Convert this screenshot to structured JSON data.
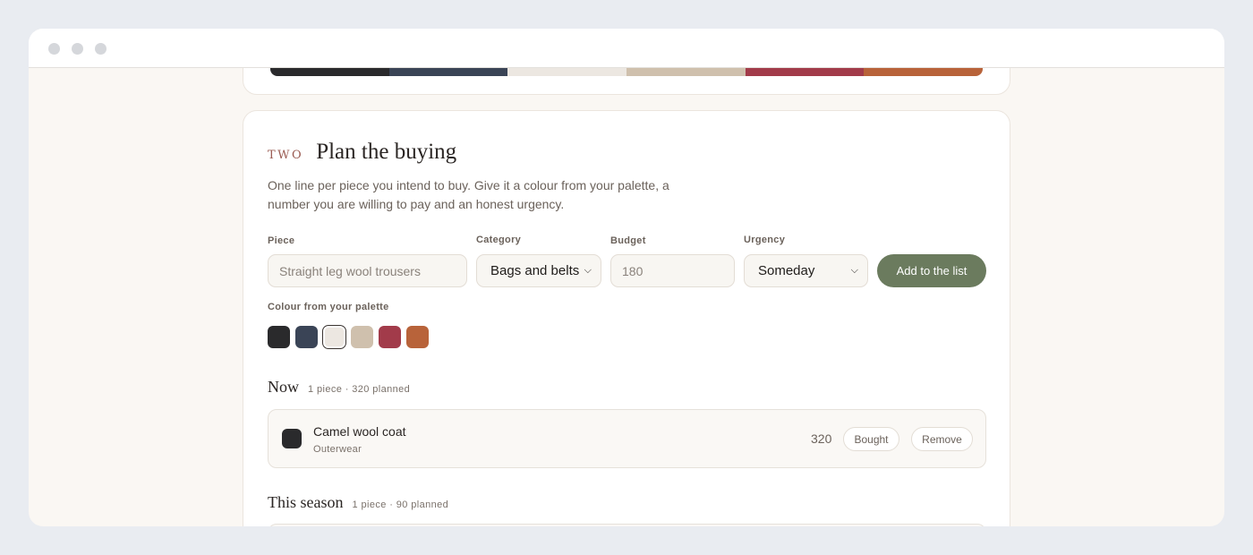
{
  "colors": {
    "palette": [
      "#2a2a2c",
      "#3a4456",
      "#ece7e1",
      "#cfc0ad",
      "#a23b4a",
      "#b8633a"
    ],
    "accent_button": "#6b7b5e",
    "step_label": "#9a5b52"
  },
  "plan": {
    "step": "TWO",
    "title": "Plan the buying",
    "description": "One line per piece you intend to buy. Give it a colour from your palette, a number you are willing to pay and an honest urgency."
  },
  "form": {
    "piece_label": "Piece",
    "piece_placeholder": "Straight leg wool trousers",
    "category_label": "Category",
    "category_value": "Bags and belts",
    "budget_label": "Budget",
    "budget_placeholder": "180",
    "urgency_label": "Urgency",
    "urgency_value": "Someday",
    "add_label": "Add to the list",
    "colour_label": "Colour from your palette",
    "selected_swatch_index": 2
  },
  "sections": [
    {
      "title": "Now",
      "meta": "1 piece · 320 planned",
      "items": [
        {
          "name": "Camel wool coat",
          "category": "Outerwear",
          "price": "320",
          "bought_label": "Bought",
          "remove_label": "Remove"
        }
      ]
    },
    {
      "title": "This season",
      "meta": "1 piece · 90 planned",
      "items": []
    }
  ]
}
